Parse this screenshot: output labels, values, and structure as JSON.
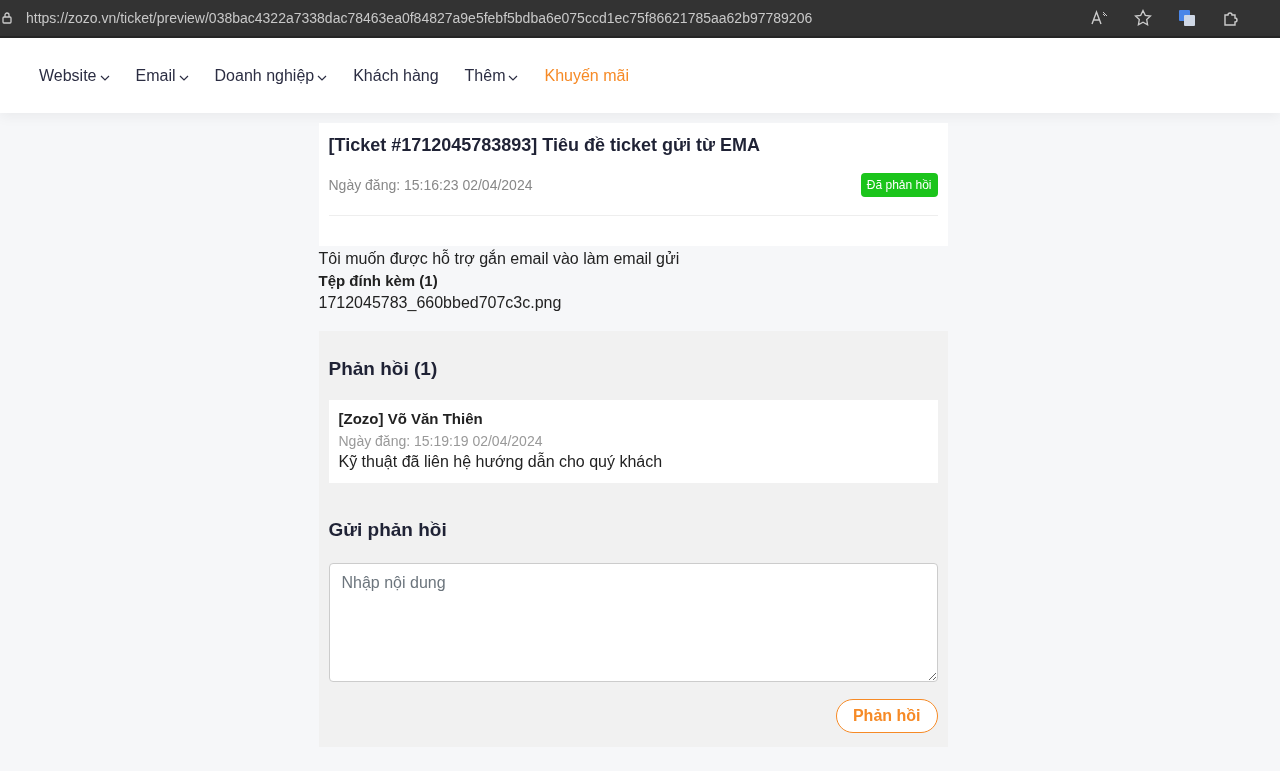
{
  "browser": {
    "url": "https://zozo.vn/ticket/preview/038bac4322a7338dac78463ea0f84827a9e5febf5bdba6e075ccd1ec75f86621785aa62b97789206"
  },
  "nav": [
    {
      "label": "Website",
      "dropdown": true,
      "highlighted": false
    },
    {
      "label": "Email",
      "dropdown": true,
      "highlighted": false
    },
    {
      "label": "Doanh nghiệp",
      "dropdown": true,
      "highlighted": false
    },
    {
      "label": "Khách hàng",
      "dropdown": false,
      "highlighted": false
    },
    {
      "label": "Thêm",
      "dropdown": true,
      "highlighted": false
    },
    {
      "label": "Khuyến mãi",
      "dropdown": false,
      "highlighted": true
    }
  ],
  "ticket": {
    "title": "[Ticket #1712045783893] Tiêu đề ticket gửi từ EMA",
    "date": "Ngày đăng: 15:16:23 02/04/2024",
    "status": "Đã phản hồi"
  },
  "body": {
    "message": "Tôi muốn được hỗ trợ gắn email vào làm email gửi",
    "attachments_label": "Tệp đính kèm (1)",
    "attachments": [
      "1712045783_660bbed707c3c.png"
    ]
  },
  "replies": {
    "heading": "Phản hồi (1)",
    "items": [
      {
        "author": "[Zozo] Võ Văn Thiên",
        "date": "Ngày đăng: 15:19:19 02/04/2024",
        "text": "Kỹ thuật đã liên hệ hướng dẫn cho quý khách"
      }
    ]
  },
  "reply_form": {
    "heading": "Gửi phản hồi",
    "placeholder": "Nhập nội dung",
    "button": "Phản hồi"
  }
}
